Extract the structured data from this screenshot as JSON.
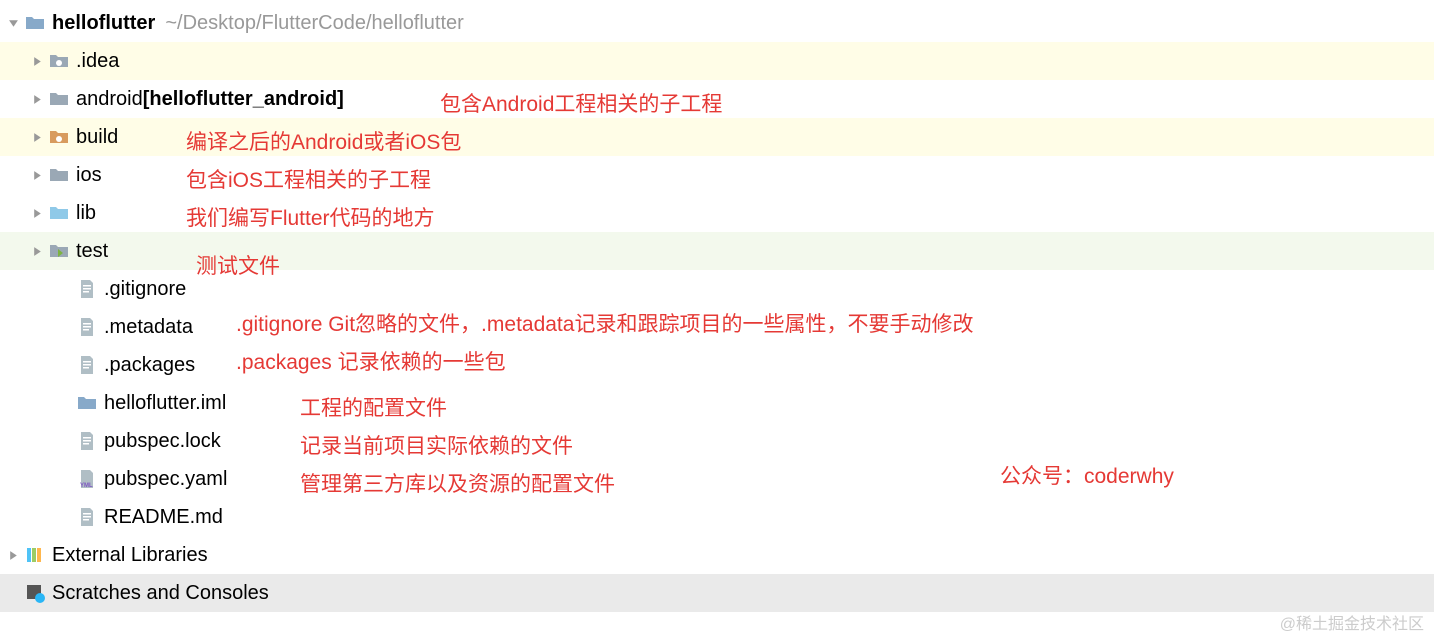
{
  "root": {
    "name": "helloflutter",
    "path": "~/Desktop/FlutterCode/helloflutter"
  },
  "items": [
    {
      "label": ".idea",
      "type": "folder-special",
      "indent": 1,
      "highlight": "yellow",
      "arrow": "right"
    },
    {
      "label": "android",
      "suffix": " [helloflutter_android]",
      "type": "folder",
      "indent": 1,
      "arrow": "right",
      "annotation": "包含Android工程相关的子工程",
      "annX": 440
    },
    {
      "label": "build",
      "type": "folder-build",
      "indent": 1,
      "highlight": "yellow",
      "arrow": "right",
      "annotation": "编译之后的Android或者iOS包",
      "annX": 186
    },
    {
      "label": "ios",
      "type": "folder-dot",
      "indent": 1,
      "arrow": "right",
      "annotation": "包含iOS工程相关的子工程",
      "annX": 186
    },
    {
      "label": "lib",
      "type": "folder-plain",
      "indent": 1,
      "arrow": "right",
      "annotation": "我们编写Flutter代码的地方",
      "annX": 186
    },
    {
      "label": "test",
      "type": "folder-test",
      "indent": 1,
      "highlight": "green",
      "arrow": "right",
      "annotation": "测试文件",
      "annX": 196
    },
    {
      "label": ".gitignore",
      "type": "file",
      "indent": 2
    },
    {
      "label": ".metadata",
      "type": "file",
      "indent": 2,
      "annotation": ".gitignore Git忽略的文件，.metadata记录和跟踪项目的一些属性，不要手动修改",
      "annX": 236
    },
    {
      "label": ".packages",
      "type": "file",
      "indent": 2,
      "annotation": ".packages 记录依赖的一些包",
      "annX": 236
    },
    {
      "label": "helloflutter.iml",
      "type": "file-iml",
      "indent": 2,
      "annotation": "工程的配置文件",
      "annX": 300
    },
    {
      "label": "pubspec.lock",
      "type": "file",
      "indent": 2,
      "annotation": "记录当前项目实际依赖的文件",
      "annX": 300
    },
    {
      "label": "pubspec.yaml",
      "type": "file-yaml",
      "indent": 2,
      "annotation": "管理第三方库以及资源的配置文件",
      "annX": 300
    },
    {
      "label": "README.md",
      "type": "file",
      "indent": 2
    }
  ],
  "external": "External Libraries",
  "scratches": "Scratches and Consoles",
  "signature": "公众号：coderwhy",
  "watermark": "@稀土掘金技术社区"
}
